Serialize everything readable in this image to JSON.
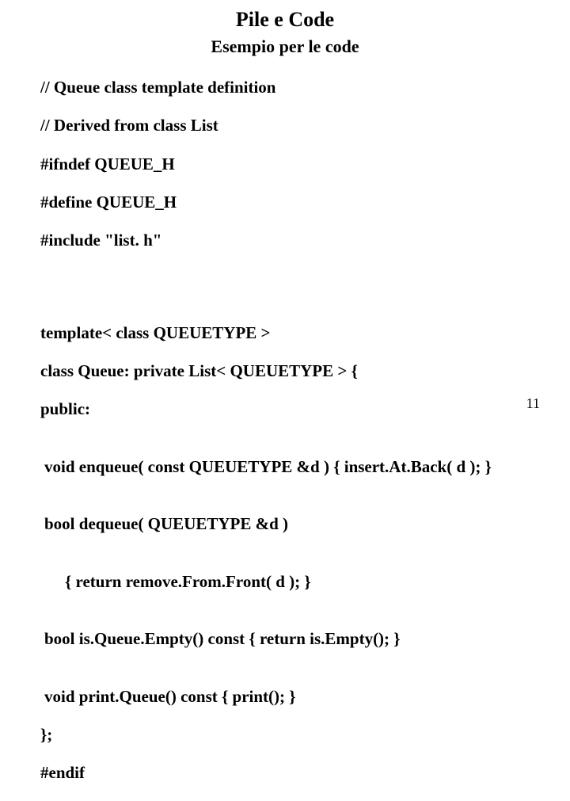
{
  "title": "Pile e Code",
  "subtitle": "Esempio per le code",
  "code": {
    "l1": "// Queue class template definition",
    "l2": "// Derived from class List",
    "l3": "#ifndef QUEUE_H",
    "l4": "#define QUEUE_H",
    "l5": "#include \"list. h\"",
    "l6": "template< class QUEUETYPE >",
    "l7": "class Queue: private List< QUEUETYPE > {",
    "l8": "public:",
    "l9": "void enqueue( const QUEUETYPE &d ) { insert.At.Back( d ); }",
    "l10": "bool dequeue( QUEUETYPE &d )",
    "l11": "{ return remove.From.Front( d ); }",
    "l12": "bool is.Queue.Empty() const { return is.Empty(); }",
    "l13": "void print.Queue() const { print(); }",
    "l14": "};",
    "l15": "#endif"
  },
  "page_number": "11"
}
